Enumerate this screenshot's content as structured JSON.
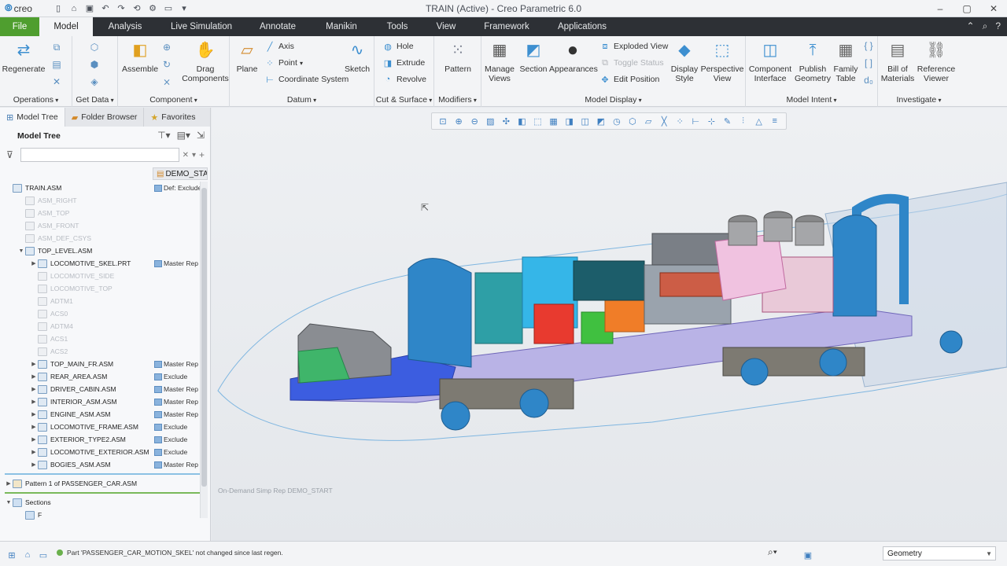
{
  "app": {
    "logo": "creo",
    "window_title": "TRAIN (Active) - Creo Parametric 6.0"
  },
  "tabs": [
    {
      "label": "File"
    },
    {
      "label": "Model"
    },
    {
      "label": "Analysis"
    },
    {
      "label": "Live Simulation"
    },
    {
      "label": "Annotate"
    },
    {
      "label": "Manikin"
    },
    {
      "label": "Tools"
    },
    {
      "label": "View"
    },
    {
      "label": "Framework"
    },
    {
      "label": "Applications"
    }
  ],
  "ribbon": {
    "operations": {
      "label": "Operations",
      "regenerate": "Regenerate"
    },
    "getdata": {
      "label": "Get Data"
    },
    "component": {
      "label": "Component",
      "assemble": "Assemble",
      "drag": "Drag Components"
    },
    "datum": {
      "label": "Datum",
      "plane": "Plane",
      "axis": "Axis",
      "point": "Point",
      "csys": "Coordinate System",
      "sketch": "Sketch"
    },
    "cut": {
      "label": "Cut & Surface",
      "hole": "Hole",
      "extrude": "Extrude",
      "revolve": "Revolve"
    },
    "modifiers": {
      "label": "Modifiers",
      "pattern": "Pattern"
    },
    "display": {
      "label": "Model Display",
      "manage": "Manage Views",
      "section": "Section",
      "appearances": "Appearances",
      "exploded": "Exploded View",
      "toggle": "Toggle Status",
      "editpos": "Edit Position",
      "style": "Display Style",
      "perspective": "Perspective View"
    },
    "intent": {
      "label": "Model Intent",
      "compint": "Component Interface",
      "publish": "Publish Geometry",
      "family": "Family Table"
    },
    "investigate": {
      "label": "Investigate",
      "bom": "Bill of Materials",
      "refview": "Reference Viewer"
    }
  },
  "nav": {
    "tabs": [
      "Model Tree",
      "Folder Browser",
      "Favorites"
    ],
    "tree_title": "Model Tree",
    "column_header": "DEMO_START"
  },
  "tree": [
    {
      "label": "TRAIN.ASM",
      "col2": "Def: Exclude",
      "dim": false,
      "exp": "",
      "indent": 0
    },
    {
      "label": "ASM_RIGHT",
      "col2": "",
      "dim": true,
      "exp": "",
      "indent": 1
    },
    {
      "label": "ASM_TOP",
      "col2": "",
      "dim": true,
      "exp": "",
      "indent": 1
    },
    {
      "label": "ASM_FRONT",
      "col2": "",
      "dim": true,
      "exp": "",
      "indent": 1
    },
    {
      "label": "ASM_DEF_CSYS",
      "col2": "",
      "dim": true,
      "exp": "",
      "indent": 1
    },
    {
      "label": "TOP_LEVEL.ASM",
      "col2": "",
      "dim": false,
      "exp": "▼",
      "indent": 1
    },
    {
      "label": "LOCOMOTIVE_SKEL.PRT",
      "col2": "Master Rep",
      "dim": false,
      "exp": "▶",
      "indent": 2
    },
    {
      "label": "LOCOMOTIVE_SIDE",
      "col2": "",
      "dim": true,
      "exp": "",
      "indent": 2
    },
    {
      "label": "LOCOMOTIVE_TOP",
      "col2": "",
      "dim": true,
      "exp": "",
      "indent": 2
    },
    {
      "label": "ADTM1",
      "col2": "",
      "dim": true,
      "exp": "",
      "indent": 2
    },
    {
      "label": "ACS0",
      "col2": "",
      "dim": true,
      "exp": "",
      "indent": 2
    },
    {
      "label": "ADTM4",
      "col2": "",
      "dim": true,
      "exp": "",
      "indent": 2
    },
    {
      "label": "ACS1",
      "col2": "",
      "dim": true,
      "exp": "",
      "indent": 2
    },
    {
      "label": "ACS2",
      "col2": "",
      "dim": true,
      "exp": "",
      "indent": 2
    },
    {
      "label": "TOP_MAIN_FR.ASM",
      "col2": "Master Rep",
      "dim": false,
      "exp": "▶",
      "indent": 2
    },
    {
      "label": "REAR_AREA.ASM",
      "col2": "Exclude",
      "dim": false,
      "exp": "▶",
      "indent": 2
    },
    {
      "label": "DRIVER_CABIN.ASM",
      "col2": "Master Rep",
      "dim": false,
      "exp": "▶",
      "indent": 2
    },
    {
      "label": "INTERIOR_ASM.ASM",
      "col2": "Master Rep",
      "dim": false,
      "exp": "▶",
      "indent": 2
    },
    {
      "label": "ENGINE_ASM.ASM",
      "col2": "Master Rep",
      "dim": false,
      "exp": "▶",
      "indent": 2
    },
    {
      "label": "LOCOMOTIVE_FRAME.ASM",
      "col2": "Exclude",
      "dim": false,
      "exp": "▶",
      "indent": 2
    },
    {
      "label": "EXTERIOR_TYPE2.ASM",
      "col2": "Exclude",
      "dim": false,
      "exp": "▶",
      "indent": 2
    },
    {
      "label": "LOCOMOTIVE_EXTERIOR.ASM",
      "col2": "Exclude",
      "dim": false,
      "exp": "▶",
      "indent": 2
    },
    {
      "label": "BOGIES_ASM.ASM",
      "col2": "Master Rep",
      "dim": false,
      "exp": "▶",
      "indent": 2
    }
  ],
  "tree_tail": {
    "pattern": "Pattern 1 of PASSENGER_CAR.ASM",
    "sections": "Sections",
    "section_item": "F"
  },
  "graphics": {
    "simp_rep": "On-Demand Simp Rep DEMO_START"
  },
  "status": {
    "message": "Part 'PASSENGER_CAR_MOTION_SKEL' not changed since last regen.",
    "filter_value": "Geometry"
  },
  "colors": {
    "file_tab": "#4f9e2f",
    "tabbar": "#2d3035",
    "body_blue": "#2f86c8"
  }
}
